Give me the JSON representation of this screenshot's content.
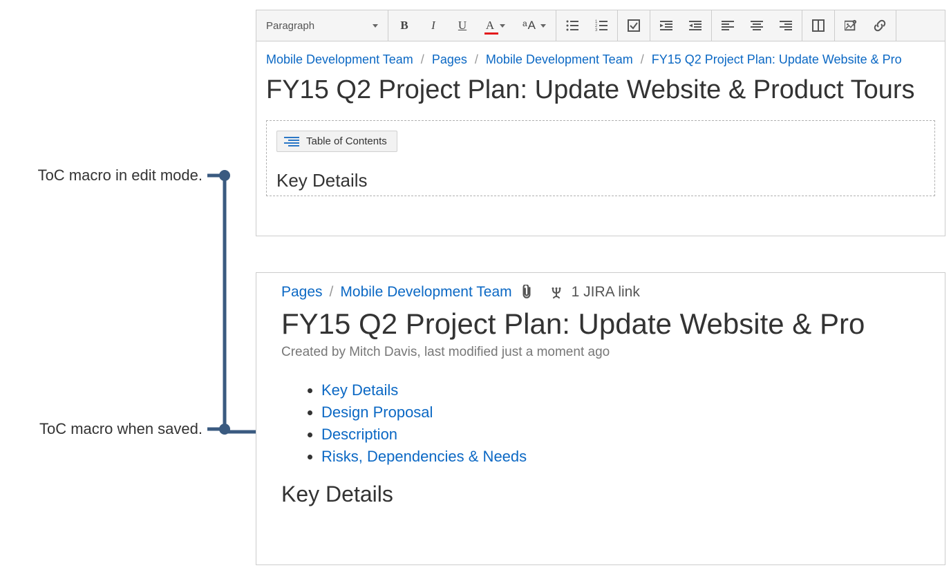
{
  "annotations": {
    "edit": "ToC macro in edit mode.",
    "view": "ToC macro when saved."
  },
  "toolbar": {
    "paragraph_label": "Paragraph"
  },
  "edit": {
    "breadcrumb": {
      "space": "Mobile Development Team",
      "pages": "Pages",
      "parent": "Mobile Development Team",
      "page": "FY15 Q2 Project Plan: Update Website & Pro"
    },
    "title": "FY15 Q2 Project Plan: Update Website & Product Tours",
    "macro_label": "Table of Contents",
    "preview_heading": "Key Details"
  },
  "view": {
    "breadcrumb": {
      "pages": "Pages",
      "space": "Mobile Development Team"
    },
    "jira_link_text": "1 JIRA link",
    "title": "FY15 Q2 Project Plan: Update Website & Pro",
    "meta": "Created by Mitch Davis, last modified just a moment ago",
    "toc_items": [
      "Key Details",
      "Design Proposal",
      "Description",
      "Risks, Dependencies & Needs"
    ],
    "heading": "Key Details"
  }
}
